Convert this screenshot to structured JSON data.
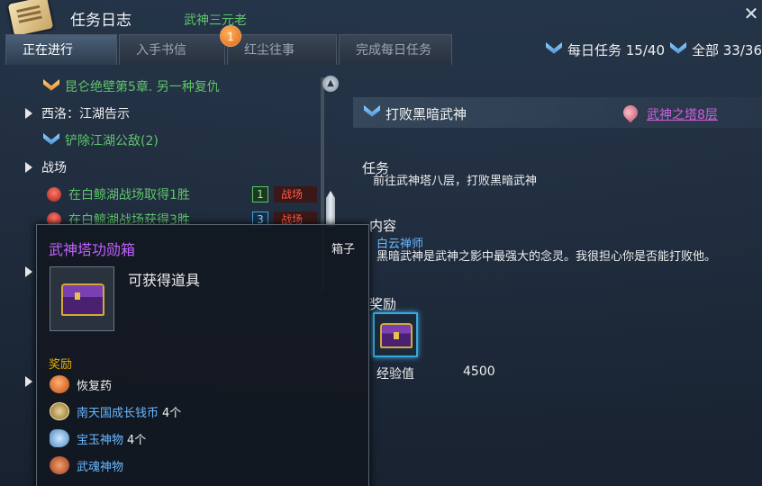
{
  "window": {
    "title": "任务日志",
    "close_glyph": "✕"
  },
  "background": {
    "npc_name": "武神三元老"
  },
  "tabs": [
    {
      "label": "正在进行"
    },
    {
      "label": "入手书信"
    },
    {
      "label": "红尘往事"
    },
    {
      "label": "完成每日任务"
    }
  ],
  "tab_badge": "1",
  "counters": {
    "daily": "每日任务 15/40",
    "all": "全部 33/36"
  },
  "quests": [
    {
      "text": "昆仑绝壁第5章. 另一种复仇",
      "kind": "quest",
      "icon": "orange-chevron-icon"
    },
    {
      "text": "西洛：江湖告示",
      "kind": "category"
    },
    {
      "text": "铲除江湖公敌(2)",
      "kind": "quest",
      "icon": "blue-chevron-icon"
    },
    {
      "text": "战场",
      "kind": "category"
    },
    {
      "text": "在白鲸湖战场取得1胜",
      "kind": "battle",
      "count": "1",
      "zone": "战场"
    },
    {
      "text": "在白鲸湖战场获得3胜",
      "kind": "battle",
      "count": "3",
      "zone": "战场"
    }
  ],
  "detail": {
    "title": "打败黑暗武神",
    "location": "武神之塔8层",
    "task_label": "任务",
    "task_text": "前往武神塔八层，打败黑暗武神",
    "content_label": "内容",
    "npc": "白云禅师",
    "content_text": "黑暗武神是武神之影中最强大的念灵。我很担心你是否能打败他。",
    "reward_label": "奖励",
    "exp_label": "经验值",
    "exp_value": "4500"
  },
  "tooltip": {
    "name": "武神塔功勋箱",
    "type": "箱子",
    "desc": "可获得道具",
    "section": "奖励",
    "items": [
      {
        "name": "恢复药",
        "count": "",
        "icon": "potion-icon",
        "color": "white"
      },
      {
        "name": "南天国成长钱币",
        "count": "4个",
        "icon": "coin-icon",
        "color": "cyan"
      },
      {
        "name": "宝玉神物",
        "count": "4个",
        "icon": "fish-icon",
        "color": "cyan"
      },
      {
        "name": "武魂神物",
        "count": "",
        "icon": "soul-icon",
        "color": "cyan"
      }
    ]
  },
  "colors": {
    "quest_green": "#5fc46a",
    "npc_blue": "#6ab8ff",
    "epic_purple": "#c060ff",
    "location_magenta": "#d060e0",
    "section_gold": "#e8b000",
    "battle_red": "#ff5a4a"
  }
}
